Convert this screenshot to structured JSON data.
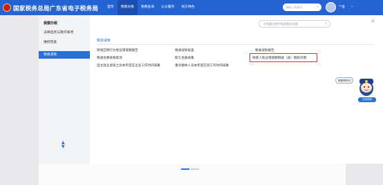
{
  "header": {
    "site_title": "国家税务总局广东省电子税务局",
    "nav": [
      {
        "label": "首页"
      },
      {
        "label": "我要办税"
      },
      {
        "label": "我要查询"
      },
      {
        "label": "公众服务"
      },
      {
        "label": "地方特色"
      }
    ],
    "search_placeholder": "请输入关键词",
    "user_name": "**金",
    "search_icon": "search-icon",
    "caret_icon": "chevron-down-icon"
  },
  "panel": {
    "sidebar": {
      "title": "我要办税",
      "items": [
        {
          "label": "法律追责与救济事项"
        },
        {
          "label": "维权检查"
        },
        {
          "label": "税收减免"
        }
      ]
    },
    "search_placeholder": "在我要办税中搜索服务功能",
    "section_title": "税收减免",
    "links": [
      {
        "label": "跨境应税行为免征增值税报告"
      },
      {
        "label": "税收减免核查"
      },
      {
        "label": "税收减免报告"
      },
      {
        "label": "税收优惠资格取消"
      },
      {
        "label": "职工名册采集"
      },
      {
        "label": "残疾人就业增值税税收（减）税权声明"
      },
      {
        "label": "自主就业退役士兵本年度在企业工作时间采集"
      },
      {
        "label": "重点群体人员本年度实际工作时间采集"
      }
    ]
  },
  "chat": {
    "bubble_text": "需要帮助吗？",
    "label": "在线导税"
  },
  "colors": {
    "header_bg": "#2364d2",
    "accent": "#2a6fdb",
    "highlight": "#e0302a"
  }
}
